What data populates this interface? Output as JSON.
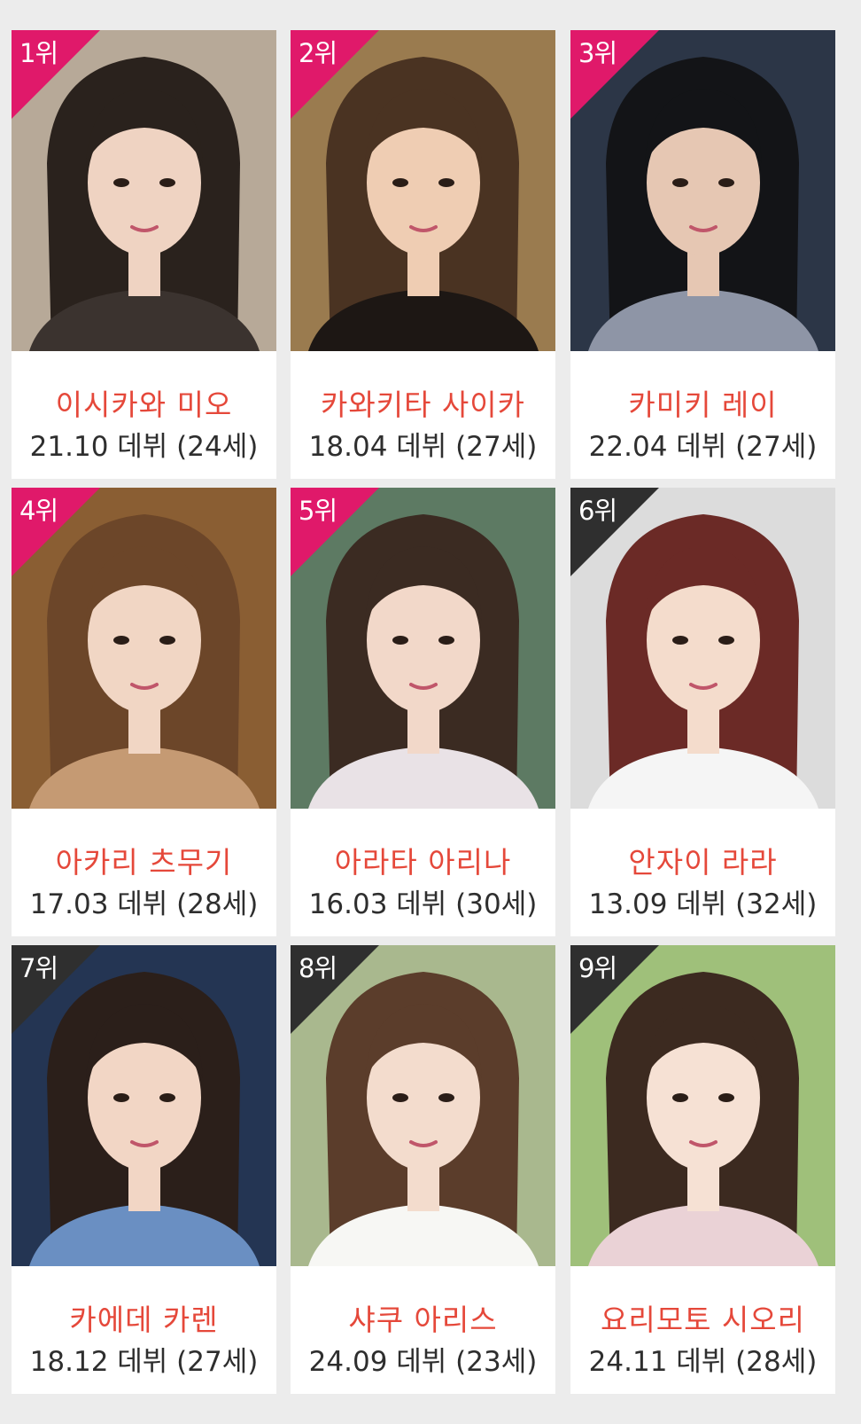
{
  "colors": {
    "background": "#ececec",
    "card": "#ffffff",
    "name_text": "#e5483a",
    "debut_text": "#2e2e2e",
    "rank_top": "#e0196a",
    "rank_other": "#2f2f2f"
  },
  "cards": [
    {
      "rank": "1위",
      "name": "이시카와 미오",
      "debut": "21.10 데뷔 (24세)",
      "rank_style": "top",
      "photo": {
        "bg": "#b7a998",
        "hair": "#2a221d",
        "skin": "#efd3c2",
        "top": "#3b332f"
      }
    },
    {
      "rank": "2위",
      "name": "카와키타 사이카",
      "debut": "18.04 데뷔 (27세)",
      "rank_style": "top",
      "photo": {
        "bg": "#9a7b4f",
        "hair": "#4a3322",
        "skin": "#efcdb3",
        "top": "#1d1714"
      }
    },
    {
      "rank": "3위",
      "name": "카미키 레이",
      "debut": "22.04 데뷔 (27세)",
      "rank_style": "top",
      "photo": {
        "bg": "#2c3647",
        "hair": "#131417",
        "skin": "#e6c7b3",
        "top": "#8e95a6"
      }
    },
    {
      "rank": "4위",
      "name": "아카리 츠무기",
      "debut": "17.03 데뷔 (28세)",
      "rank_style": "top",
      "photo": {
        "bg": "#8a5e33",
        "hair": "#6c4629",
        "skin": "#f1d6c4",
        "top": "#c59a73"
      }
    },
    {
      "rank": "5위",
      "name": "아라타 아리나",
      "debut": "16.03 데뷔 (30세)",
      "rank_style": "top",
      "photo": {
        "bg": "#5d7a63",
        "hair": "#3b2b22",
        "skin": "#f2d8c9",
        "top": "#e9e2e6"
      }
    },
    {
      "rank": "6위",
      "name": "안자이 라라",
      "debut": "13.09 데뷔 (32세)",
      "rank_style": "other",
      "photo": {
        "bg": "#dcdcdc",
        "hair": "#6b2a26",
        "skin": "#f4dccc",
        "top": "#f5f5f5"
      }
    },
    {
      "rank": "7위",
      "name": "카에데 카렌",
      "debut": "18.12 데뷔 (27세)",
      "rank_style": "other",
      "photo": {
        "bg": "#243553",
        "hair": "#2b1f1a",
        "skin": "#f2d6c5",
        "top": "#6a8fc2"
      }
    },
    {
      "rank": "8위",
      "name": "샤쿠 아리스",
      "debut": "24.09 데뷔 (23세)",
      "rank_style": "other",
      "photo": {
        "bg": "#a9b88e",
        "hair": "#5b3d2b",
        "skin": "#f3dccd",
        "top": "#f7f7f4"
      }
    },
    {
      "rank": "9위",
      "name": "요리모토 시오리",
      "debut": "24.11 데뷔 (28세)",
      "rank_style": "other",
      "photo": {
        "bg": "#9fc07a",
        "hair": "#3c2a20",
        "skin": "#f6e1d4",
        "top": "#ead2d6"
      }
    }
  ]
}
